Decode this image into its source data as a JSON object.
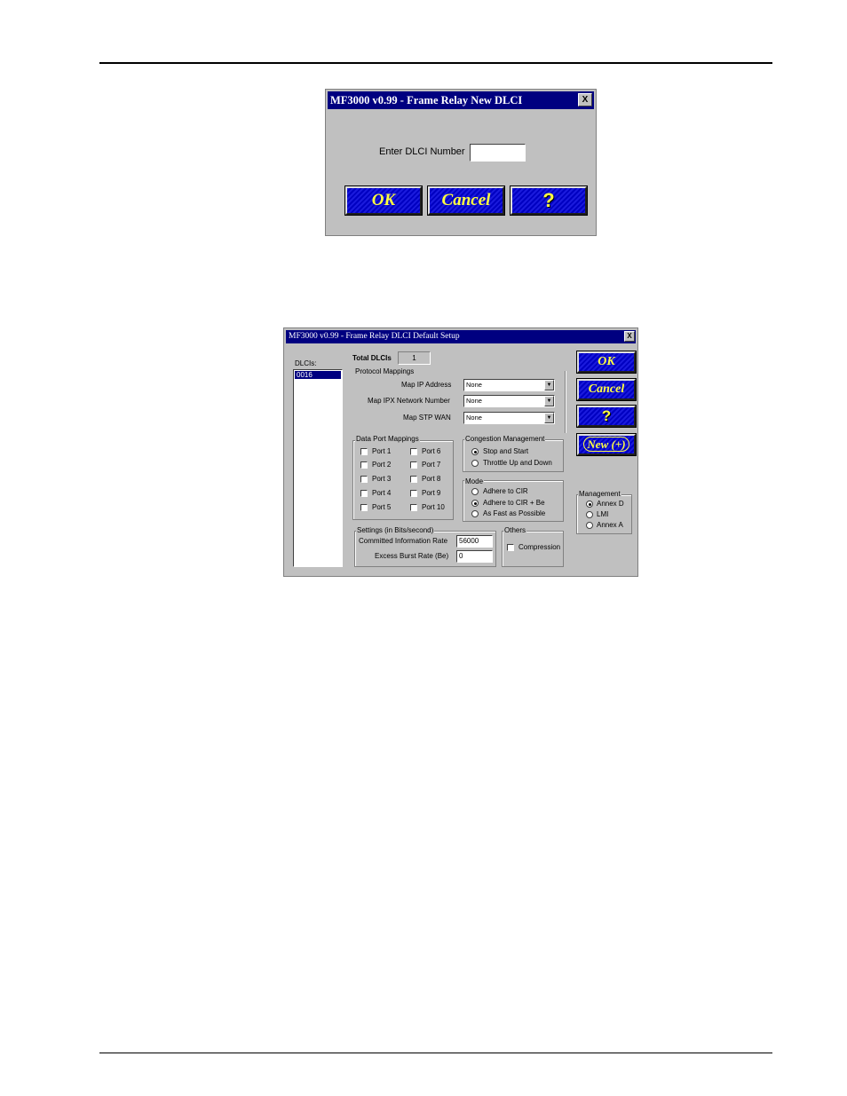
{
  "dialog_new": {
    "title": "MF3000 v0.99 - Frame Relay New DLCI",
    "close": "X",
    "prompt": "Enter DLCI Number",
    "value": "",
    "ok": "OK",
    "cancel": "Cancel",
    "help": "?"
  },
  "dialog_setup": {
    "title": "MF3000 v0.99 - Frame Relay DLCI Default Setup",
    "close": "X",
    "dlcis_label": "DLCIs:",
    "dlci_list": [
      "0016"
    ],
    "total_label": "Total DLCIs",
    "total_value": "1",
    "protocol": {
      "title": "Protocol Mappings",
      "rows": [
        {
          "label": "Map IP Address",
          "value": "None"
        },
        {
          "label": "Map IPX Network Number",
          "value": "None"
        },
        {
          "label": "Map STP WAN",
          "value": "None"
        }
      ]
    },
    "buttons": {
      "ok": "OK",
      "cancel": "Cancel",
      "help": "?",
      "new": "New (+)"
    },
    "data_port": {
      "title": "Data Port Mappings",
      "ports": [
        "Port 1",
        "Port 2",
        "Port 3",
        "Port 4",
        "Port 5",
        "Port 6",
        "Port 7",
        "Port 8",
        "Port 9",
        "Port 10"
      ]
    },
    "congestion": {
      "title": "Congestion Management",
      "options": [
        "Stop and Start",
        "Throttle Up and Down"
      ],
      "selected": "Stop and Start"
    },
    "mode": {
      "title": "Mode",
      "options": [
        "Adhere to CIR",
        "Adhere to CIR + Be",
        "As Fast as Possible"
      ],
      "selected": "Adhere to CIR + Be"
    },
    "management": {
      "title": "Management",
      "options": [
        "Annex D",
        "LMI",
        "Annex A"
      ],
      "selected": "Annex D"
    },
    "settings": {
      "title": "Settings (in Bits/second)",
      "cir_label": "Committed Information Rate",
      "cir_value": "56000",
      "be_label": "Excess Burst Rate (Be)",
      "be_value": "0"
    },
    "others": {
      "title": "Others",
      "compression_label": "Compression"
    }
  }
}
